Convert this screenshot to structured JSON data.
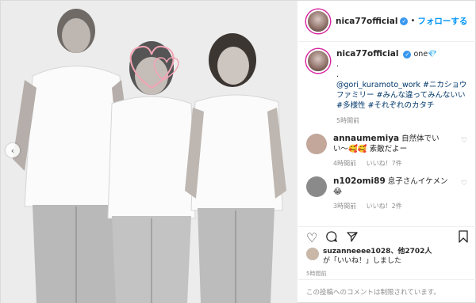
{
  "post": {
    "username": "nica77official",
    "verified_mark": "✓",
    "follow_separator": "•",
    "follow_label": "フォローする",
    "caption_word": "one",
    "caption_gem": "💎",
    "caption_dots": [
      ".",
      "."
    ],
    "caption_body": "@gori_kuramoto_work #ニカショウファミリー #みんな違ってみんないい #多様性 #それぞれのカタチ",
    "caption_time": "5時間前"
  },
  "comments": [
    {
      "username": "annaumemiya",
      "text": "自然体でいい〜🥰🥰 素敵だよー",
      "time": "4時間前",
      "likes": "いいね！7件",
      "avatar_color": "#c2a79a"
    },
    {
      "username": "n102omi89",
      "text": "息子さんイケメン😂",
      "time": "3時間前",
      "likes": "いいね！2件",
      "avatar_color": "#8a8a8a"
    }
  ],
  "actions": {
    "like_icon": "heart-icon",
    "comment_icon": "comment-icon",
    "share_icon": "share-icon",
    "bookmark_icon": "bookmark-icon"
  },
  "likes": {
    "line1": "suzanneeee1028、他2702人",
    "line2": "が「いいね！」しました"
  },
  "post_time": "5時間前",
  "footer": {
    "text": "この投稿へのコメントは制限されています。"
  },
  "colors": {
    "accent": "#0095f6",
    "verified": "#3897f0",
    "muted": "#8e8e8e"
  }
}
